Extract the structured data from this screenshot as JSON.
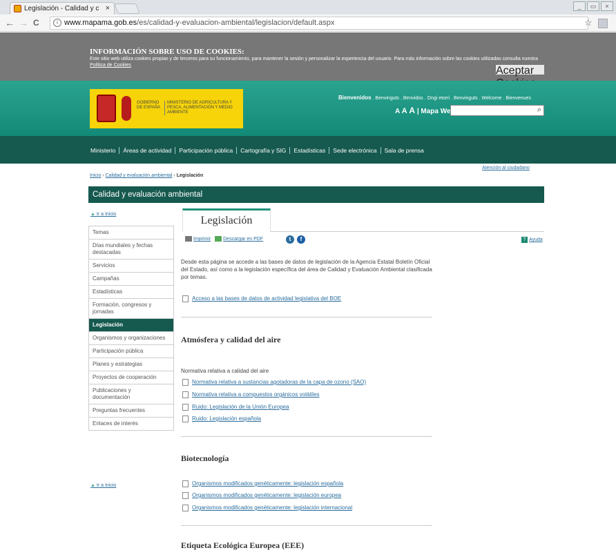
{
  "browser": {
    "tab_title": "Legislación - Calidad y c",
    "tab_close": "×",
    "url_host": "www.mapama.gob.es",
    "url_path": "/es/calidad-y-evaluacion-ambiental/legislacion/default.aspx",
    "back": "←",
    "forward": "→",
    "reload": "C",
    "info": "i",
    "star": "☆",
    "win_min": "_",
    "win_restore": "▭",
    "win_close": "×"
  },
  "cookies": {
    "title": "INFORMACIÓN SOBRE USO DE COOKIES:",
    "text": "Este sitio web utiliza cookies propias y de terceros para su funcionamiento, para mantener la sesión y personalizar la experiencia del usuario. Para más información sobre las cookies utilizadas consulta nuestra",
    "policy_link": "Política de Cookies",
    "accept": "Aceptar Cookies"
  },
  "header": {
    "gobierno": "GOBIERNO DE ESPAÑA",
    "ministerio": "MINISTERIO DE AGRICULTURA Y PESCA, ALIMENTACIÓN Y MEDIO AMBIENTE",
    "welcome_bold": "Bienvenidos",
    "welcome_rest": " . Benvinguts . Benvidos . Ongi etorri . Benvinguts . Welcome . Bienvenues",
    "aaa_small": "A",
    "aaa_mid": "A",
    "aaa_big": "A",
    "mapa_web": "| Mapa Web",
    "search_icon": "⌕"
  },
  "nav": [
    "Ministerio",
    "Áreas de actividad",
    "Participación pública",
    "Cartografía y SIG",
    "Estadísticas",
    "Sede electrónica",
    "Sala de prensa"
  ],
  "breadcrumb": {
    "inicio": "Inicio",
    "sep1": " › ",
    "section": "Calidad y evaluación ambiental",
    "sep2": " › ",
    "current": "Legislación"
  },
  "atencion": "Atención al ciudadano",
  "section_title": "Calidad y evaluación ambiental",
  "ir_inicio": "Ir a Inicio",
  "arrow_up": "▲",
  "sidebar": [
    "Temas",
    "Días mundiales y fechas destacadas",
    "Servicios",
    "Campañas",
    "Estadísticas",
    "Formación, congresos y jornadas",
    "Legislación",
    "Organismos y organizaciones",
    "Participación pública",
    "Planes y estrategias",
    "Proyectos de cooperación",
    "Publicaciones y documentación",
    "Preguntas frecuentes",
    "Enlaces de interés"
  ],
  "sidebar_active": "Legislación",
  "page": {
    "title": "Legislación",
    "imprimir": "Imprimir",
    "descargar": "Descargar en PDF",
    "twitter": "t",
    "facebook": "f",
    "ayuda_icon": "?",
    "ayuda": "Ayuda",
    "intro": "Desde esta página se accede a las bases de datos de legislación de la Agencia Estatal Boletín Oficial del Estado, así como a la legislación específica del área de Calidad y Evaluación Ambiental clasificada por temas.",
    "boe_link": "Acceso a las bases de datos de actividad legislativa del BOE"
  },
  "sections": [
    {
      "title": "Atmósfera y calidad del aire",
      "subtitle": "Normativa relativa a calidad del aire",
      "links": [
        "Normativa relativa a sustancias agotadoras de la capa de ozono (SAO)",
        "Normativa relativa a compuestos orgánicos volátiles",
        "Ruido: Legislación de la Unión Europea",
        "Ruido: Legislación española"
      ]
    },
    {
      "title": "Biotecnología",
      "links": [
        "Organismos modificados genéticamente: legislación española",
        "Organismos modificados genéticamente: legislación europea",
        "Organismos modificados genéticamente: legislación internacional"
      ]
    },
    {
      "title": "Etiqueta Ecológica Europea (EEE)"
    }
  ]
}
